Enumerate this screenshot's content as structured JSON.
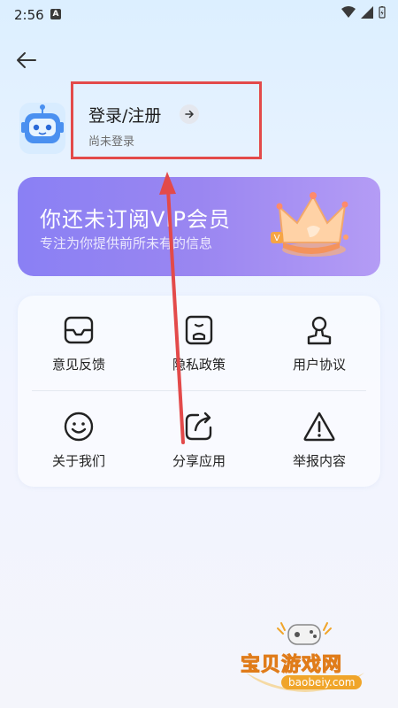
{
  "status_bar": {
    "time": "2:56",
    "notification_letter": "A"
  },
  "header": {
    "login_title": "登录/注册",
    "login_subtitle": "尚未登录"
  },
  "vip_banner": {
    "title": "你还未订阅VIP会员",
    "subtitle": "专注为你提供前所未有的信息",
    "badge": "V"
  },
  "menu": {
    "items": [
      {
        "label": "意见反馈",
        "icon": "feedback-icon"
      },
      {
        "label": "隐私政策",
        "icon": "privacy-icon"
      },
      {
        "label": "用户协议",
        "icon": "user-agreement-icon"
      },
      {
        "label": "关于我们",
        "icon": "smile-icon"
      },
      {
        "label": "分享应用",
        "icon": "share-icon"
      },
      {
        "label": "举报内容",
        "icon": "warning-icon"
      }
    ]
  },
  "watermark": {
    "text": "宝贝游戏网",
    "url": "baobeiy.com"
  },
  "colors": {
    "vip_gradient_start": "#8a80f4",
    "annotation_red": "#e34a4a",
    "watermark_orange": "#f0a52a"
  }
}
